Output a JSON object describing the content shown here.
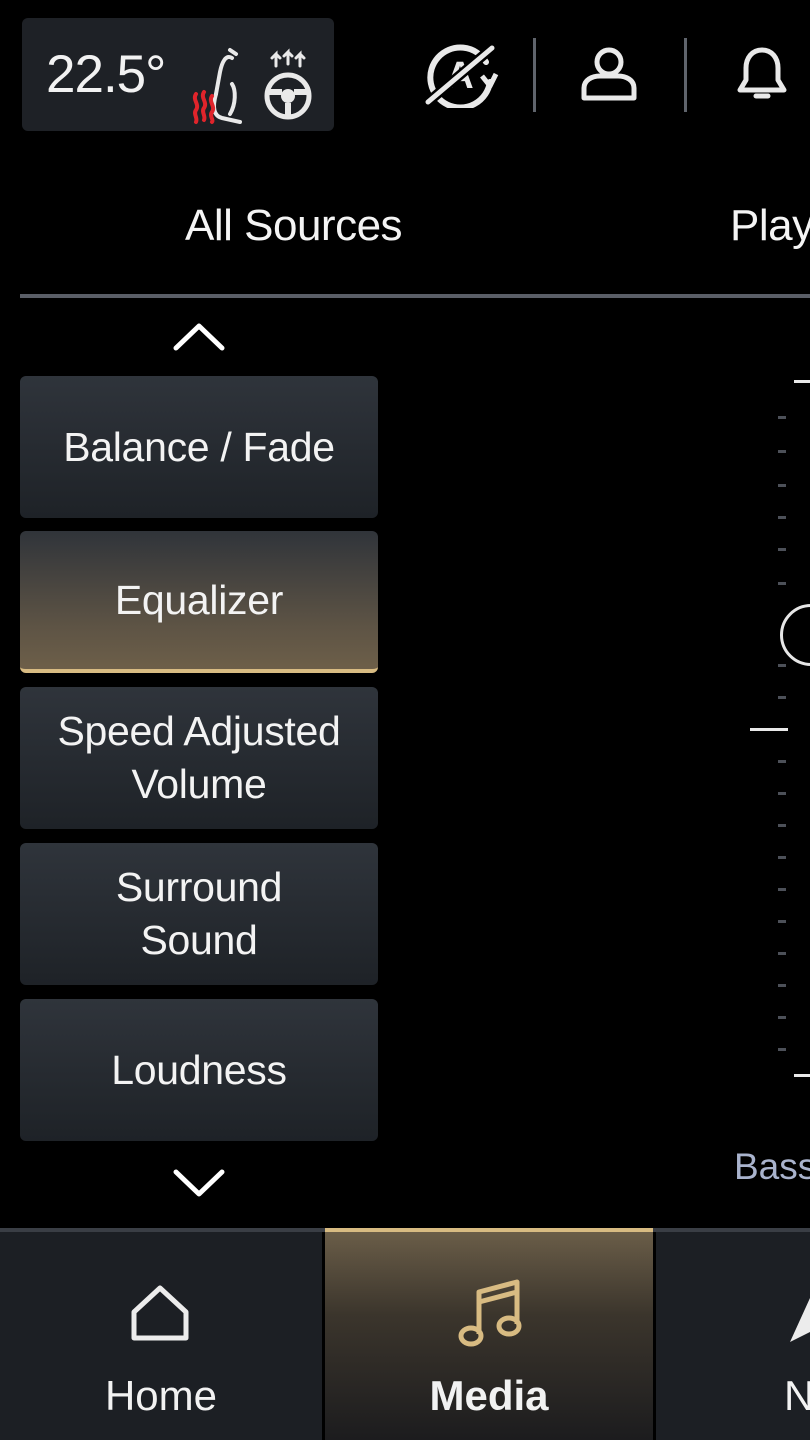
{
  "status_bar": {
    "temperature": "22.5°",
    "icons": {
      "heated_seat": "heated-seat-icon",
      "heated_wheel": "heated-steering-wheel-icon",
      "auto_stop_start": "auto-start-stop-off-icon",
      "profile": "user-profile-icon",
      "notifications": "bell-icon"
    }
  },
  "tabs": [
    {
      "label": "All Sources"
    },
    {
      "label": "Play"
    }
  ],
  "audio_menu": {
    "items": [
      {
        "line1": "Balance / Fade",
        "line2": ""
      },
      {
        "line1": "Equalizer",
        "line2": ""
      },
      {
        "line1": "Speed Adjusted",
        "line2": "Volume"
      },
      {
        "line1": "Surround",
        "line2": "Sound"
      },
      {
        "line1": "Loudness",
        "line2": ""
      }
    ],
    "selected": "Equalizer"
  },
  "slider": {
    "label": "Bass"
  },
  "bottom_nav": {
    "items": [
      {
        "label": "Home",
        "icon": "home-icon"
      },
      {
        "label": "Media",
        "icon": "music-note-icon"
      },
      {
        "label": "N",
        "icon": "navigation-arrow-icon"
      }
    ],
    "selected": "Media"
  },
  "colors": {
    "accent_gold": "#d8bb82",
    "background": "#000000",
    "button": "#2a2e34",
    "heat_red": "#e0242b",
    "secondary_text": "#a9b3cd"
  }
}
